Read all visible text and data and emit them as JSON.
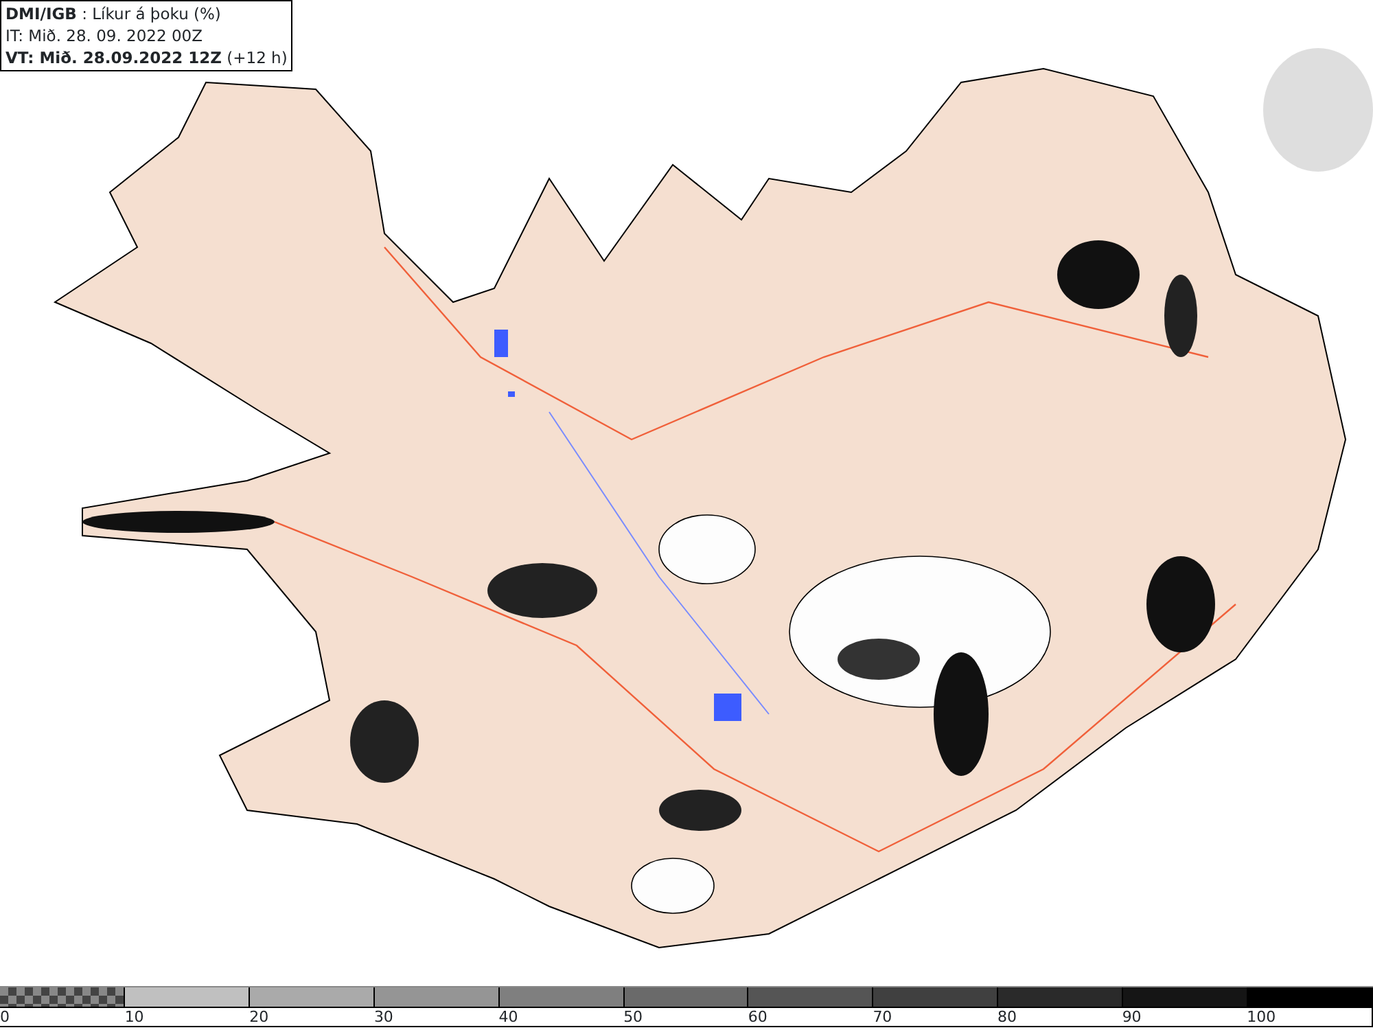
{
  "header": {
    "title": "**DMI/IGB** : Líkur á þoku (%)",
    "initial_time": "IT: Mið. 28. 09. 2022 00Z",
    "valid_time": "**VT: Mið. 28.09.2022 12Z** (+12 h)"
  },
  "legend": [
    {
      "label": "0",
      "kind": "checker"
    },
    {
      "label": "10",
      "kind": "solid",
      "color": "#c0c0c0"
    },
    {
      "label": "20",
      "kind": "solid",
      "color": "#aaaaaa"
    },
    {
      "label": "30",
      "kind": "solid",
      "color": "#959595"
    },
    {
      "label": "40",
      "kind": "solid",
      "color": "#7f7f7f"
    },
    {
      "label": "50",
      "kind": "solid",
      "color": "#6a6a6a"
    },
    {
      "label": "60",
      "kind": "solid",
      "color": "#555555"
    },
    {
      "label": "70",
      "kind": "solid",
      "color": "#404040"
    },
    {
      "label": "80",
      "kind": "solid",
      "color": "#2a2a2a"
    },
    {
      "label": "90",
      "kind": "solid",
      "color": "#151515"
    },
    {
      "label": "100",
      "kind": "solid",
      "color": "#000000"
    }
  ]
}
